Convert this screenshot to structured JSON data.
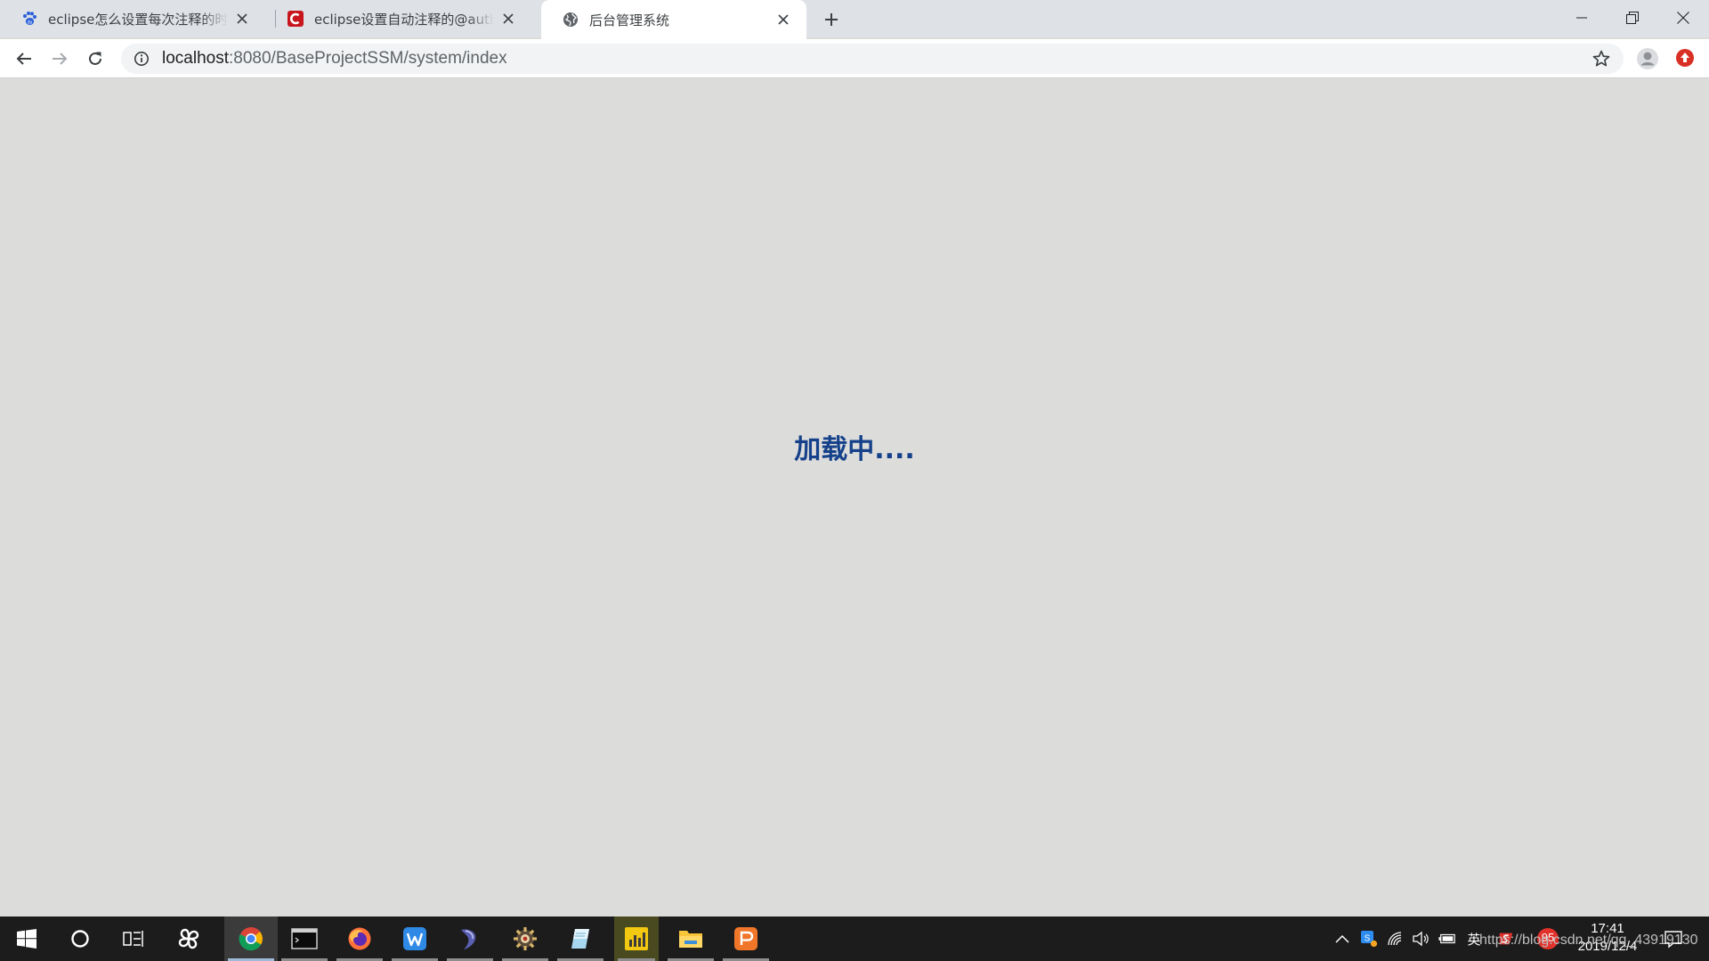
{
  "tabs": [
    {
      "title": "eclipse怎么设置每次注释的时候",
      "favicon": "paw-icon",
      "active": false
    },
    {
      "title": "eclipse设置自动注释的@author",
      "favicon": "csdn-icon",
      "active": false
    },
    {
      "title": "后台管理系统",
      "favicon": "globe-icon",
      "active": true
    }
  ],
  "address": {
    "host": "localhost",
    "rest": ":8080/BaseProjectSSM/system/index"
  },
  "page": {
    "loading_text": "加载中...."
  },
  "taskbar": {
    "apps": [
      "windows-start-icon",
      "cortana-icon",
      "task-view-icon",
      "pinwheel-app-icon",
      "chrome-icon",
      "terminal-icon",
      "firefox-icon",
      "wps-icon",
      "eclipse-icon",
      "settings-gear-icon",
      "notepad-icon",
      "chart-app-icon",
      "file-explorer-icon",
      "slides-app-icon"
    ],
    "tray_ime": "英",
    "tray_badge": "95",
    "time": "17:41",
    "date": "2019/12/4",
    "watermark": "https://blog.csdn.net/qq_43919130"
  },
  "colors": {
    "loading_text": "#15418a",
    "content_bg": "#dcdcdb",
    "tabstrip_bg": "#dee1e6",
    "taskbar_bg": "#1c1c1c"
  }
}
